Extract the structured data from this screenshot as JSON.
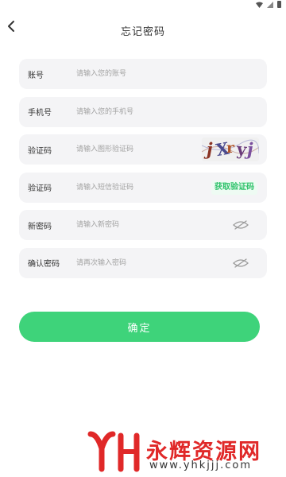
{
  "header": {
    "title": "忘记密码"
  },
  "form": {
    "rows": [
      {
        "label": "账号",
        "placeholder": "请输入您的账号"
      },
      {
        "label": "手机号",
        "placeholder": "请输入您的手机号"
      },
      {
        "label": "验证码",
        "placeholder": "请输入图形验证码",
        "captcha_text": "jXryj"
      },
      {
        "label": "验证码",
        "placeholder": "请输入短信验证码",
        "action_label": "获取验证码"
      },
      {
        "label": "新密码",
        "placeholder": "请输入新密码"
      },
      {
        "label": "确认密码",
        "placeholder": "请再次输入密码"
      }
    ]
  },
  "confirm_label": "确定",
  "watermark": {
    "name": "永辉资源网",
    "url": "www.yhkjjj.com"
  },
  "colors": {
    "accent": "#3ed37a",
    "field_bg": "#f4f4f6",
    "watermark_red": "#e02828"
  },
  "icons": {
    "back": "chevron-left-icon",
    "password_visibility": "eye-closed-icon"
  }
}
